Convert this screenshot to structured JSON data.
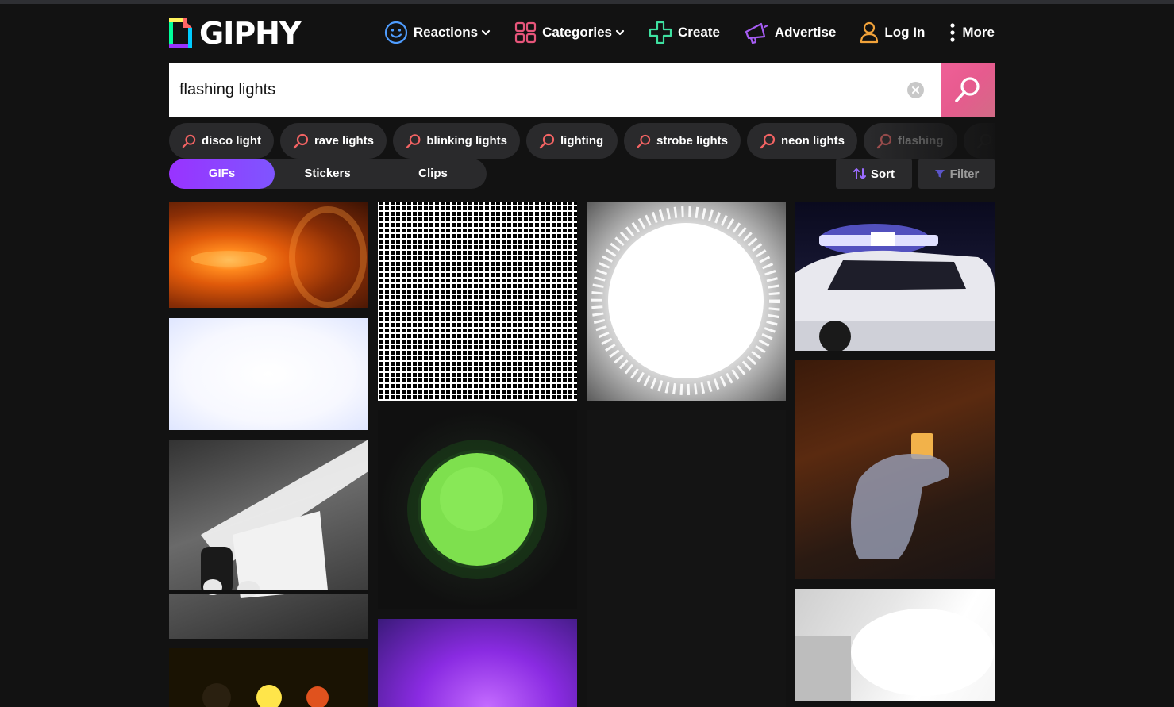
{
  "brand": {
    "name": "GIPHY"
  },
  "nav": {
    "reactions": "Reactions",
    "categories": "Categories",
    "create": "Create",
    "advertise": "Advertise",
    "login": "Log In",
    "more": "More"
  },
  "search": {
    "value": "flashing lights"
  },
  "suggestions": [
    "disco light",
    "rave lights",
    "blinking lights",
    "lighting",
    "strobe lights",
    "neon lights",
    "flashing"
  ],
  "tabs": [
    "GIFs",
    "Stickers",
    "Clips"
  ],
  "active_tab": "GIFs",
  "tools": {
    "sort": "Sort",
    "filter": "Filter"
  },
  "colors": {
    "background": "#121212",
    "surface": "#2a2a2c",
    "accent_purple": "#9933ff",
    "search_pink": "#e65b8e",
    "search_icon": "#f26363"
  }
}
